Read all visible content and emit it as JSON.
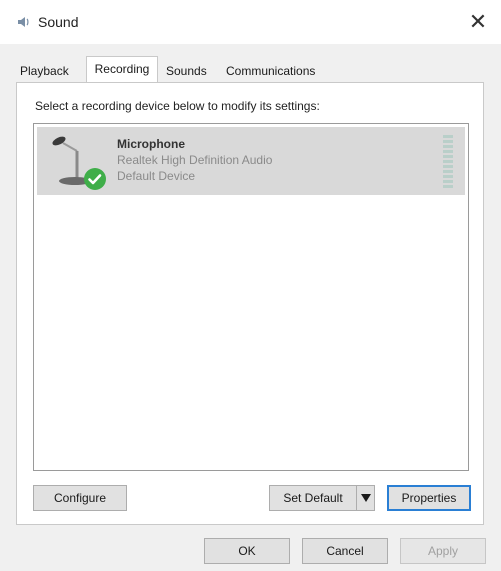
{
  "window": {
    "title": "Sound",
    "close_symbol": "✕"
  },
  "tabs": [
    {
      "label": "Playback",
      "active": false
    },
    {
      "label": "Recording",
      "active": true
    },
    {
      "label": "Sounds",
      "active": false
    },
    {
      "label": "Communications",
      "active": false
    }
  ],
  "recording": {
    "instruction": "Select a recording device below to modify its settings:",
    "devices": [
      {
        "name": "Microphone",
        "driver": "Realtek High Definition Audio",
        "status": "Default Device",
        "icon": "microphone-icon",
        "badge": "green-check-icon",
        "selected": true
      }
    ]
  },
  "panel_buttons": {
    "configure": "Configure",
    "set_default": "Set Default",
    "properties": "Properties"
  },
  "dialog_buttons": {
    "ok": "OK",
    "cancel": "Cancel",
    "apply": "Apply"
  },
  "colors": {
    "selection": "#d9d9d9",
    "accent": "#2a7fd4",
    "check_green": "#3fae49"
  }
}
